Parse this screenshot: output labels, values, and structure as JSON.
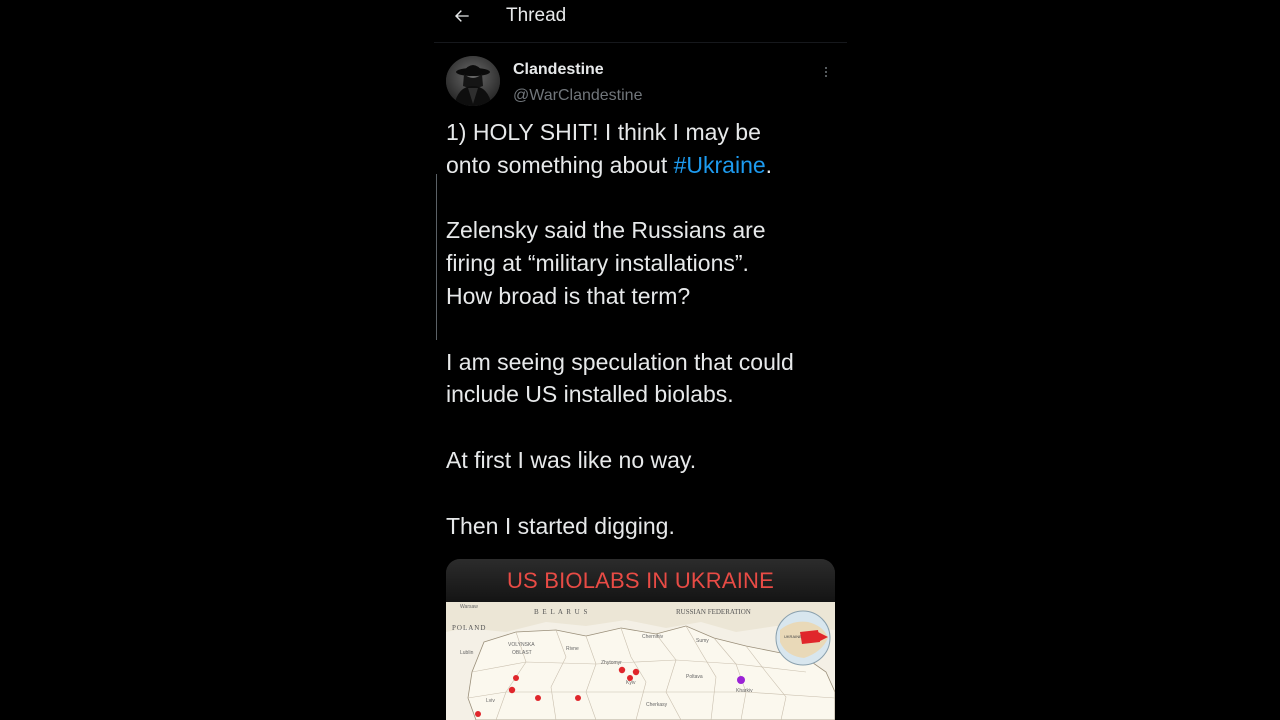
{
  "header": {
    "title": "Thread"
  },
  "tweet": {
    "author_name": "Clandestine",
    "author_handle": "@WarClandestine",
    "paragraphs": [
      [
        "1) HOLY SHIT! I think I may be",
        "onto something about ",
        "#Ukraine",
        "."
      ],
      [
        "Zelensky said the Russians are",
        "firing at “military installations”.",
        "How broad is that term?"
      ],
      [
        "I am seeing speculation that could",
        "include US installed biolabs."
      ],
      [
        "At first I was like no way."
      ],
      [
        "Then I started digging."
      ]
    ]
  },
  "media": {
    "title": "US BIOLABS IN UKRAINE",
    "map_labels": {
      "poland": "POLAND",
      "belarus": "B E L A R U S",
      "russia": "RUSSIAN FEDERATION",
      "volynska": "VOLYNSKA",
      "oblast": "OBLAST",
      "kyiv": "Kyiv",
      "kharkiv": "Kharkiv",
      "warsaw": "Warsaw",
      "lublin": "Lublin",
      "chernihiv": "Chernihiv",
      "sumy": "Sumy",
      "poltava": "Poltava",
      "rivne": "Rivne",
      "zhytomyr": "Zhytomyr",
      "lviv": "Lviv",
      "cherkasy": "Cherkasy",
      "inset": "UKRAINE"
    },
    "lab_color": "#e0262b",
    "highlight_color": "#9b22d6"
  },
  "colors": {
    "background": "#000000",
    "text": "#e7e9ea",
    "muted": "#71767b",
    "link": "#1d9bf0",
    "media_title": "#e84b45"
  },
  "icons": {
    "back": "arrow-left-icon",
    "more": "more-vertical-icon",
    "avatar": "hooded-figure-avatar"
  }
}
